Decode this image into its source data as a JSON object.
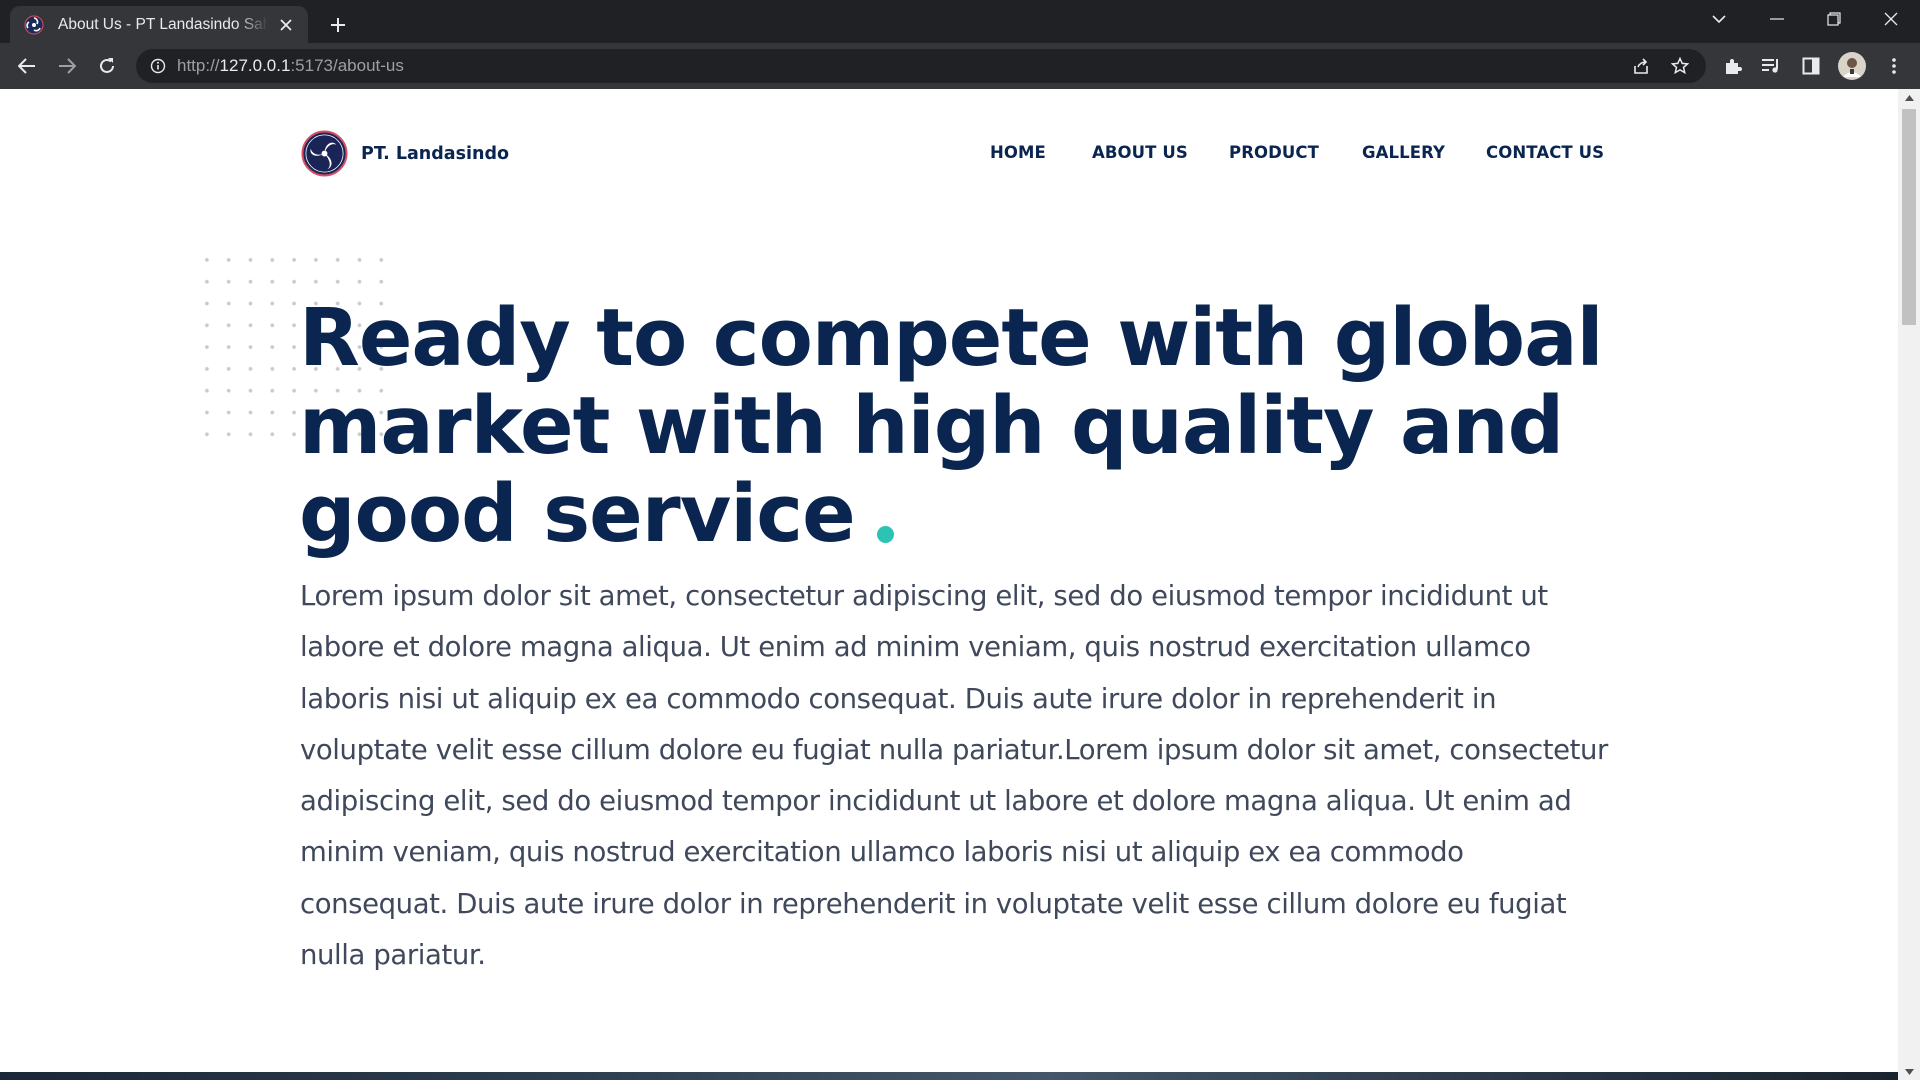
{
  "browser": {
    "tab_title": "About Us - PT Landasindo Sahu Perkasa",
    "url_prefix": "http://",
    "url_host": "127.0.0.1",
    "url_rest": ":5173/about-us",
    "icons": {
      "back": "back-arrow-icon",
      "forward": "forward-arrow-icon",
      "reload": "reload-icon",
      "info": "info-icon",
      "share": "share-icon",
      "bookmark": "star-icon",
      "extensions": "puzzle-icon",
      "media": "media-queue-icon",
      "side_panel": "side-panel-icon",
      "profile": "avatar",
      "menu": "kebab-menu-icon"
    }
  },
  "site": {
    "brand_name": "PT. Landasindo",
    "nav": [
      "HOME",
      "ABOUT US",
      "PRODUCT",
      "GALLERY",
      "CONTACT US"
    ]
  },
  "hero": {
    "title_line1": "Ready to compete with global",
    "title_line2": "market with high quality and",
    "title_line3": "good service",
    "body": "Lorem ipsum dolor sit amet, consectetur adipiscing elit, sed do eiusmod tempor incididunt ut labore et dolore magna aliqua. Ut enim ad minim veniam, quis nostrud exercitation ullamco laboris nisi ut aliquip ex ea commodo consequat. Duis aute irure dolor in reprehenderit in voluptate velit esse cillum dolore eu fugiat nulla pariatur.Lorem ipsum dolor sit amet, consectetur adipiscing elit, sed do eiusmod tempor incididunt ut labore et dolore magna aliqua. Ut enim ad minim veniam, quis nostrud exercitation ullamco laboris nisi ut aliquip ex ea commodo consequat. Duis aute irure dolor in reprehenderit in voluptate velit esse cillum dolore eu fugiat nulla pariatur."
  },
  "colors": {
    "navy": "#0a2550",
    "accent_teal": "#2cc3b5",
    "body_text": "#40495c",
    "chrome_dark": "#202124",
    "chrome_toolbar": "#35363a"
  }
}
